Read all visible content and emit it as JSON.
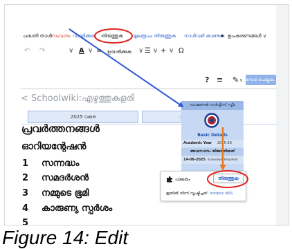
{
  "toolbar": {
    "tabs": [
      {
        "label": "പദ്ധതി താൾ"
      },
      {
        "label": "സംവാദം"
      },
      {
        "label": "വായിക്കുക"
      },
      {
        "label": "തിരുത്തുക"
      },
      {
        "label": "മൂലരൂപം തിരുത്തുക"
      },
      {
        "label": "നാൾവഴി കാണുക"
      }
    ],
    "watch_icon": "★",
    "tools_label": "ഉപകരണങ്ങൾ",
    "chevron": "∨"
  },
  "editor_toolbar": {
    "undo_icon": "↶",
    "redo_icon": "↷",
    "chevron": "∨",
    "text_style_icon": "A",
    "link_icon": "∞",
    "cite_label": "ഉദ്ധരിക്കുക",
    "list_icon": "☰",
    "insert_icon": "+",
    "special_chars_icon": "Ω",
    "help_icon": "?",
    "page_options_icon": "≡",
    "edit_mode_icon": "✎",
    "save_label": "സേവ് ചെയ്യുക..."
  },
  "page": {
    "back_icon": "<",
    "title": "Schoolwiki:എഴുത്തുകളരി",
    "tabs": [
      {
        "label": "2025 വരെ"
      },
      {
        "label": "2025-26"
      }
    ]
  },
  "content": {
    "heading": "പ്രവർത്തനങ്ങൾ",
    "subheading": "ഓറിയന്റേഷൻ",
    "items": [
      {
        "num": "1",
        "label": "സന്നദ്ധം"
      },
      {
        "num": "2",
        "label": "സമദർശൻ"
      },
      {
        "num": "3",
        "label": "നമ്മുടെ ഭൂമി"
      },
      {
        "num": "4",
        "label": "കാരുണ്യ സ്പർശം"
      },
      {
        "num": "5",
        "label": ""
      }
    ]
  },
  "infobox": {
    "title": "നാഷണൽ സർവ്വീസ് സ്കീം",
    "section": "Basic Details",
    "academic_year_label": "Academic Year",
    "academic_year": "2025-26",
    "last_edited_label": "അവസാനം തിരുത്തിയത്",
    "last_edited_date": "14-08-2025",
    "last_edited_by": "Schoolwikihelpdesk"
  },
  "popup": {
    "type_label": "ഫലകം",
    "edit_label": "തിരുത്തുക",
    "source_prefix": "ഇതിൽ നിന്ന് സൃഷ്ടിച്ചത്:",
    "source_link": "Infobox NSS"
  },
  "caption": "Figure 14: Edit",
  "colors": {
    "link": "#3366cc",
    "save_button": "#8fb3ea",
    "infobox": "#c6d8f3",
    "annotation_blue": "#2f56d6",
    "annotation_red": "#e0231e",
    "annotation_orange": "#e87a20"
  }
}
